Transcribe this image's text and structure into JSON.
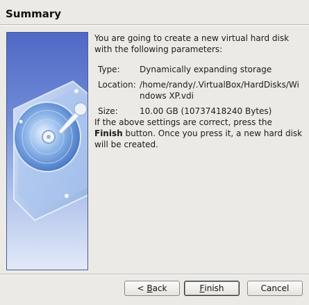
{
  "title": "Summary",
  "intro": "You are going to create a new virtual hard disk with the following parameters:",
  "params": {
    "type_label": "Type:",
    "type_value": "Dynamically expanding storage",
    "location_label": "Location:",
    "location_value_line1": "/home/randy/.VirtualBox/HardDisks/Wi",
    "location_value_line2": "ndows XP.vdi",
    "size_label": "Size:",
    "size_value": "10.00 GB (10737418240 Bytes)"
  },
  "note": {
    "before": "If the above settings are correct, press the",
    "bold": "Finish",
    "after": "button. Once you press it, a new hard disk will be created."
  },
  "buttons": {
    "back_prefix": "< ",
    "back_mnemonic": "B",
    "back_rest": "ack",
    "finish_mnemonic": "F",
    "finish_rest": "inish",
    "cancel": "Cancel"
  },
  "image_icon": "hard-disk-icon",
  "colors": {
    "side_top": "#4f68c6",
    "side_bottom": "#e2e9f8",
    "background": "#ebeae6"
  }
}
